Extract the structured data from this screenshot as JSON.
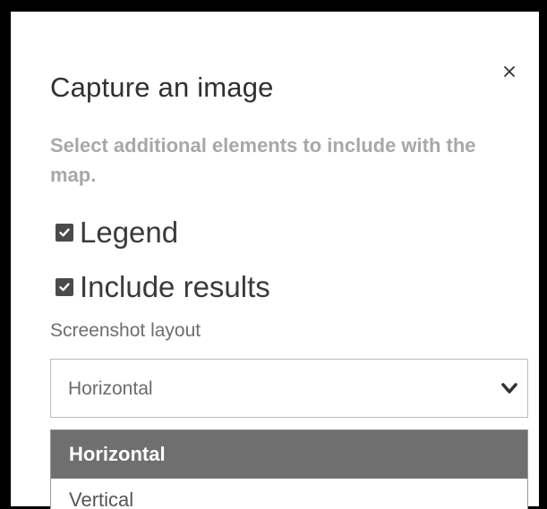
{
  "dialog": {
    "title": "Capture an image",
    "description": "Select additional elements to include with the map.",
    "close_icon": "close-icon"
  },
  "options": {
    "legend": {
      "label": "Legend",
      "checked": true
    },
    "include_results": {
      "label": "Include results",
      "checked": true
    }
  },
  "layout": {
    "label": "Screenshot layout",
    "selected_value": "Horizontal",
    "chevron_icon": "chevron-down-icon",
    "options": [
      "Horizontal",
      "Vertical"
    ]
  },
  "colors": {
    "checkbox": "#4a4a4a",
    "highlight": "#6f6f6f",
    "title": "#303030",
    "description": "#a8a8a8"
  }
}
